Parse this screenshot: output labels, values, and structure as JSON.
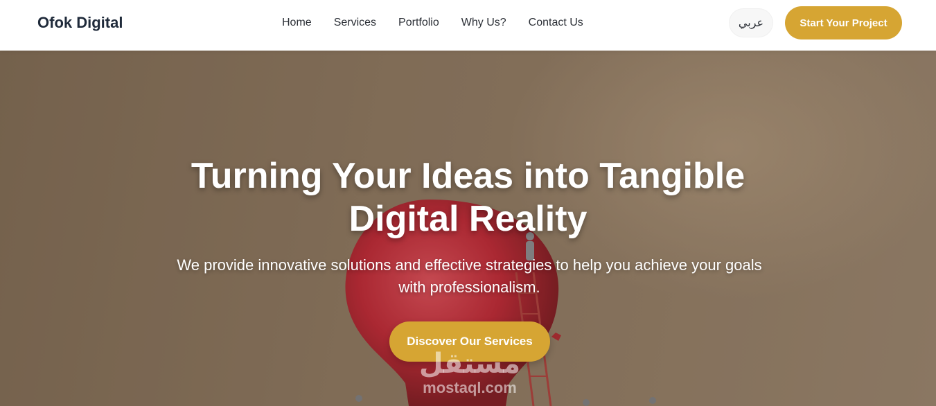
{
  "brand": "Ofok Digital",
  "nav": {
    "items": [
      "Home",
      "Services",
      "Portfolio",
      "Why Us?",
      "Contact Us"
    ]
  },
  "header": {
    "language_label": "عربي",
    "cta_label": "Start Your Project"
  },
  "hero": {
    "title_line1": "Turning Your Ideas into Tangible",
    "title_line2": "Digital Reality",
    "subtitle_line1": "We provide innovative solutions and effective strategies to help you achieve your goals",
    "subtitle_line2": "with professionalism.",
    "button_label": "Discover Our Services"
  },
  "watermark": {
    "arabic": "مستقل",
    "domain": "mostaql.com"
  },
  "colors": {
    "accent": "#d6a533",
    "brand_text": "#1f2a3a",
    "hero_bg": "#8c7862"
  }
}
